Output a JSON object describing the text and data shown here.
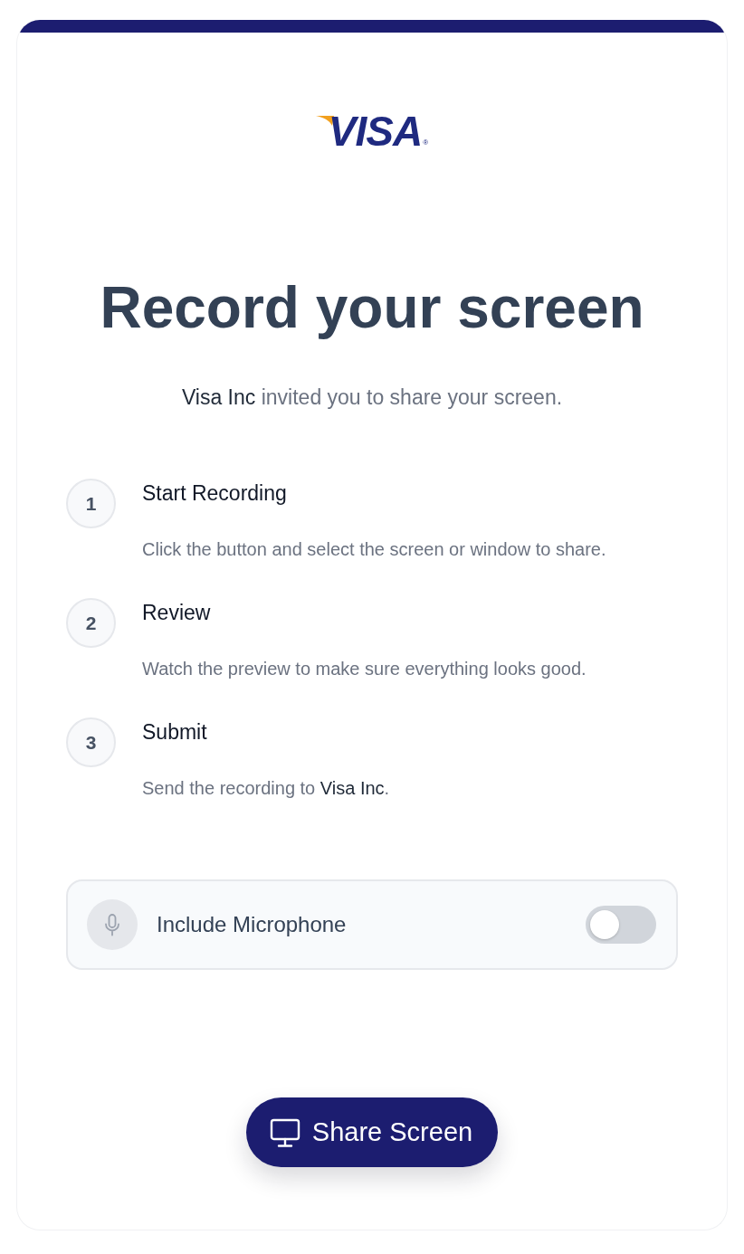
{
  "logo": {
    "text": "VISA",
    "mark": "®"
  },
  "title": "Record your screen",
  "subtitle": "**Visa Inc** invited you to share your screen.",
  "steps": [
    {
      "number": "1",
      "title": "Start Recording",
      "description": "Click the button and select the screen or window to share."
    },
    {
      "number": "2",
      "title": "Review",
      "description": "Watch the preview to make sure everything looks good."
    },
    {
      "number": "3",
      "title": "Submit",
      "description": "Send the recording to **Visa Inc**."
    }
  ],
  "microphone": {
    "label": "Include Microphone",
    "on": false
  },
  "share_button": {
    "label": "Share Screen"
  }
}
